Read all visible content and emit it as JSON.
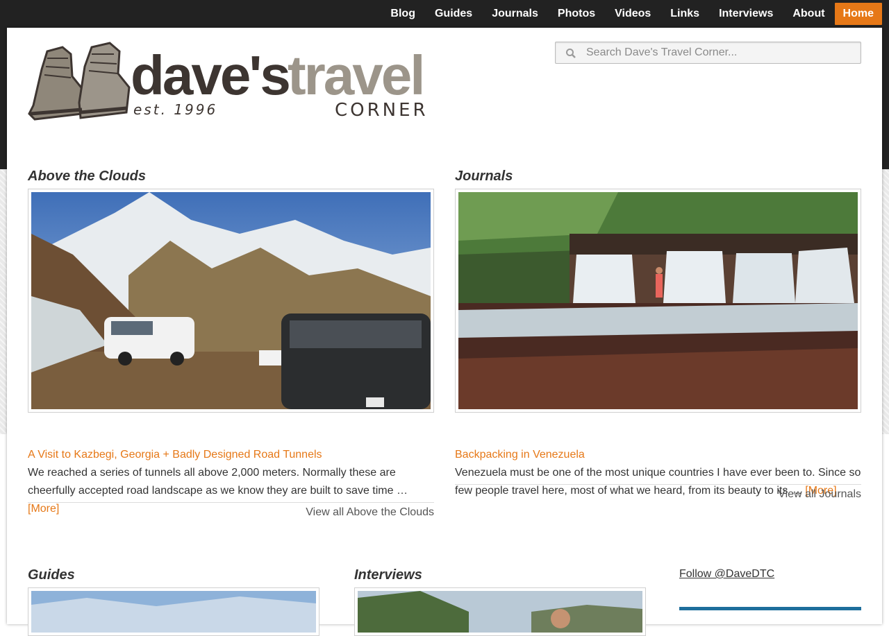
{
  "nav": {
    "items": [
      "Blog",
      "Guides",
      "Journals",
      "Photos",
      "Videos",
      "Links",
      "Interviews",
      "About"
    ],
    "active": "Home"
  },
  "logo": {
    "word_daves": "dave's",
    "word_travel": "travel",
    "established": "est. 1996",
    "corner": "CORNER"
  },
  "search": {
    "placeholder": "Search Dave's Travel Corner..."
  },
  "sections": {
    "clouds": {
      "title": "Above the Clouds",
      "article_title": "A Visit to Kazbegi, Georgia + Badly Designed Road Tunnels",
      "body": "We reached a series of tunnels all above 2,000 meters. Normally these are cheerfully accepted road landscape as we know they are built to save time …",
      "more": "[More]",
      "view_all": "View all Above the Clouds"
    },
    "journals": {
      "title": "Journals",
      "article_title": "Backpacking in Venezuela",
      "body": "Venezuela must be one of the most unique countries I have ever been to. Since so few people travel here, most of what we heard, from its beauty to its …",
      "more": "[More]",
      "view_all": "View all Journals"
    },
    "guides": {
      "title": "Guides"
    },
    "interviews": {
      "title": "Interviews"
    }
  },
  "sidebar": {
    "follow": "Follow @DaveDTC"
  },
  "colors": {
    "accent": "#e67817",
    "topbar": "#222222",
    "twitter_bar": "#1e6e9c"
  }
}
